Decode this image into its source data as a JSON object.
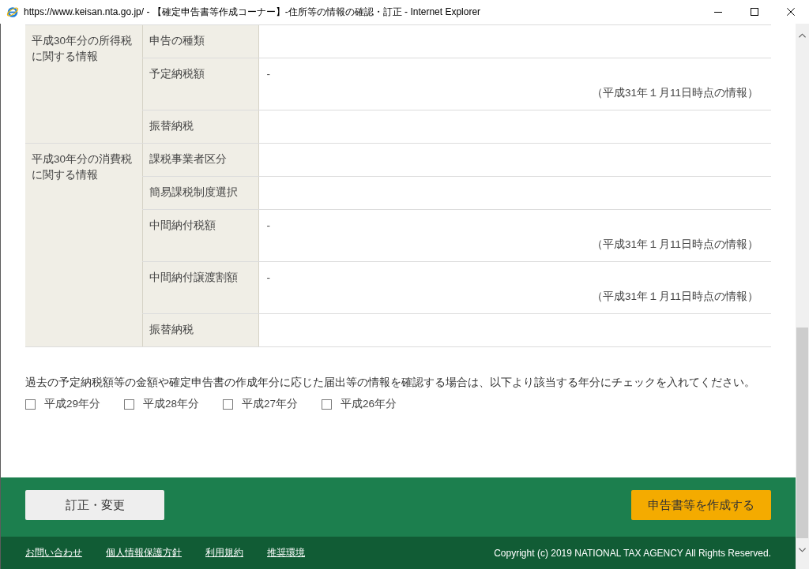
{
  "window": {
    "title": "https://www.keisan.nta.go.jp/ - 【確定申告書等作成コーナー】-住所等の情報の確認・訂正 - Internet Explorer"
  },
  "info_table": {
    "groups": [
      {
        "heading": "平成30年分の所得税に関する情報",
        "rows": [
          {
            "label": "申告の種類"
          },
          {
            "label": "予定納税額",
            "value": "-",
            "note": "（平成31年１月11日時点の情報）"
          },
          {
            "label": "振替納税"
          }
        ]
      },
      {
        "heading": "平成30年分の消費税に関する情報",
        "rows": [
          {
            "label": "課税事業者区分"
          },
          {
            "label": "簡易課税制度選択"
          },
          {
            "label": "中間納付税額",
            "value": "-",
            "note": "（平成31年１月11日時点の情報）"
          },
          {
            "label": "中間納付譲渡割額",
            "value": "-",
            "note": "（平成31年１月11日時点の情報）"
          },
          {
            "label": "振替納税"
          }
        ]
      }
    ]
  },
  "past_years": {
    "instruction": "過去の予定納税額等の金額や確定申告書の作成年分に応じた届出等の情報を確認する場合は、以下より該当する年分にチェックを入れてください。",
    "options": [
      {
        "label": "平成29年分",
        "checked": false
      },
      {
        "label": "平成28年分",
        "checked": false
      },
      {
        "label": "平成27年分",
        "checked": false
      },
      {
        "label": "平成26年分",
        "checked": false
      }
    ]
  },
  "actions": {
    "buttons": [
      {
        "label": "訂正・変更",
        "kind": "secondary"
      },
      {
        "label": "申告書等を作成する",
        "kind": "primary"
      }
    ]
  },
  "footer": {
    "links": [
      "お問い合わせ",
      "個人情報保護方針",
      "利用規約",
      "推奨環境"
    ],
    "copyright": "Copyright (c) 2019 NATIONAL TAX AGENCY All Rights Reserved."
  }
}
